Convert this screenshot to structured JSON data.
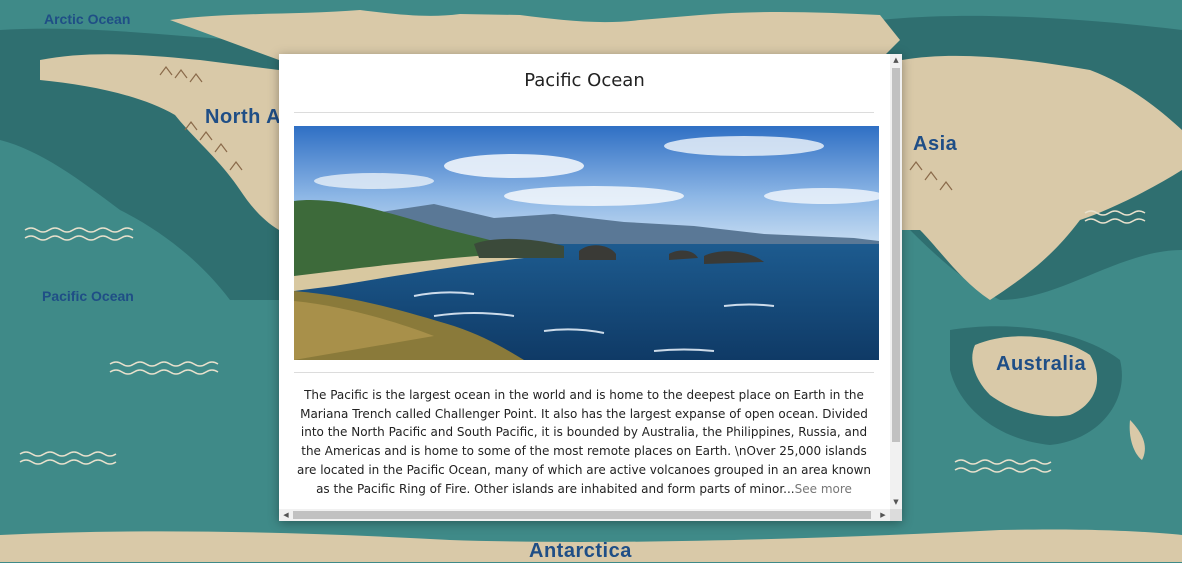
{
  "map": {
    "oceans": {
      "arctic": "Arctic Ocean",
      "pacific": "Pacific Ocean"
    },
    "continents": {
      "north_america": "North Am",
      "asia": "Asia",
      "australia": "Australia",
      "antarctica": "Antarctica"
    },
    "colors": {
      "ocean": "#3f8a88",
      "shelf": "#2f6f70",
      "land": "#d9c9a8",
      "label": "#1f4e86"
    }
  },
  "modal": {
    "title": "Pacific Ocean",
    "image_alt": "Pacific coastline",
    "description": "The Pacific is the largest ocean in the world and is home to the deepest place on Earth in the Mariana Trench called Challenger Point. It also has the largest expanse of open ocean. Divided into the North Pacific and South Pacific, it is bounded by Australia, the Philippines, Russia, and the Americas and is home to some of the most remote places on Earth. \\nOver 25,000 islands are located in the Pacific Ocean, many of which are active volcanoes grouped in an area known as the Pacific Ring of Fire. Other islands are inhabited and form parts of minor...",
    "see_more": "See more"
  }
}
